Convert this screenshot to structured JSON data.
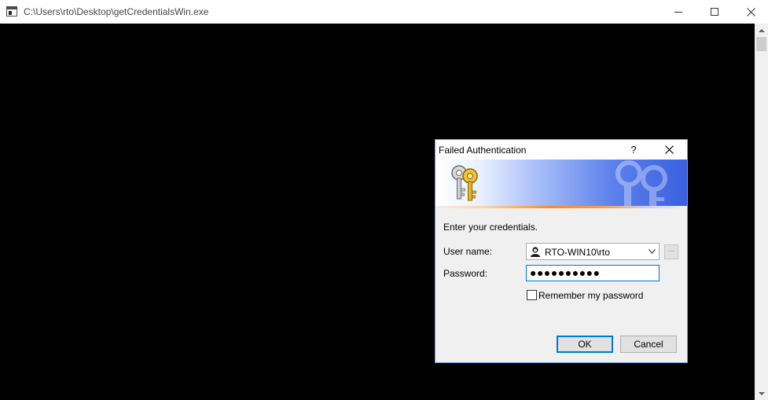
{
  "console": {
    "title": "C:\\Users\\rto\\Desktop\\getCredentialsWin.exe"
  },
  "dialog": {
    "title": "Failed Authentication",
    "help_label": "?",
    "prompt": "Enter your credentials.",
    "username_label": "User name:",
    "username_value": "RTO-WIN10\\rto",
    "browse_label": "...",
    "password_label": "Password:",
    "password_value": "●●●●●●●●●●",
    "remember_label": "Remember my password",
    "remember_checked": false,
    "ok_label": "OK",
    "cancel_label": "Cancel"
  },
  "icons": {
    "console_app": "console-app-icon",
    "banner": "keys-icon",
    "user": "user-icon"
  },
  "colors": {
    "console_background": "#000000",
    "focus_border": "#0078d7",
    "banner_blue": "#3a5fe0",
    "banner_orange": "#ff8a1c"
  }
}
